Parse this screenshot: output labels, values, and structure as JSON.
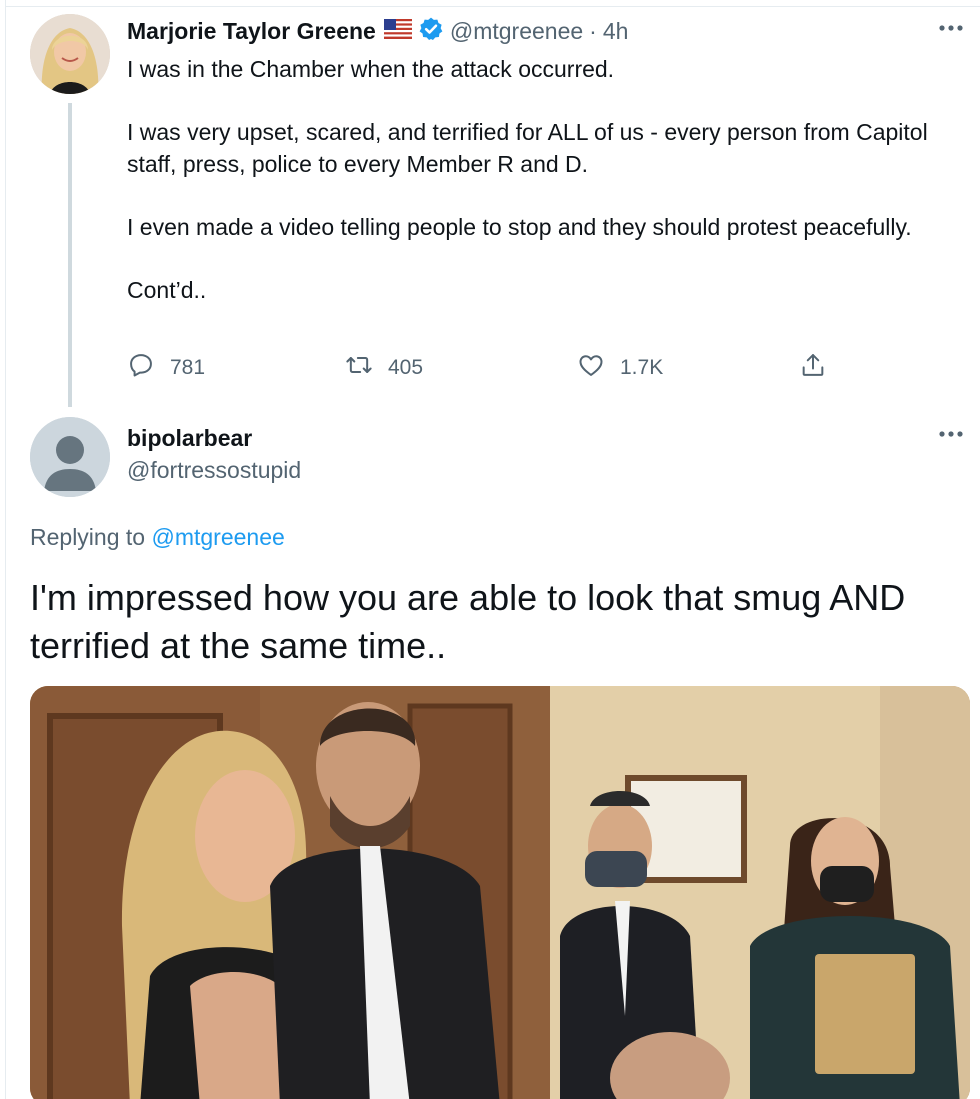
{
  "tweet": {
    "author_name": "Marjorie Taylor Greene",
    "author_handle": "@mtgreenee",
    "separator": "·",
    "time": "4h",
    "paragraphs": [
      "I was in the Chamber when the attack occurred.",
      "I was very upset, scared, and terrified for ALL of us - every person from Capitol staff, press, police to every Member R and D.",
      "I even made a video telling people to stop and they should protest peacefully.",
      "Cont’d.."
    ],
    "replies": "781",
    "retweets": "405",
    "likes": "1.7K"
  },
  "reply": {
    "author_name": "bipolarbear",
    "author_handle": "@fortressostupid",
    "replying_prefix": "Replying to",
    "replying_handle": "@mtgreenee",
    "text": "I'm impressed how you are able to look that smug AND terrified at the same time.."
  },
  "icons": {
    "verified": "verified-badge-icon",
    "flag": "us-flag-icon",
    "more": "more-options-icon",
    "reply": "reply-icon",
    "retweet": "retweet-icon",
    "like": "like-icon",
    "share": "share-icon"
  },
  "colors": {
    "link": "#1d9bf0",
    "secondary_text": "#536471",
    "primary_text": "#0f1419",
    "verified": "#1d9bf0"
  }
}
